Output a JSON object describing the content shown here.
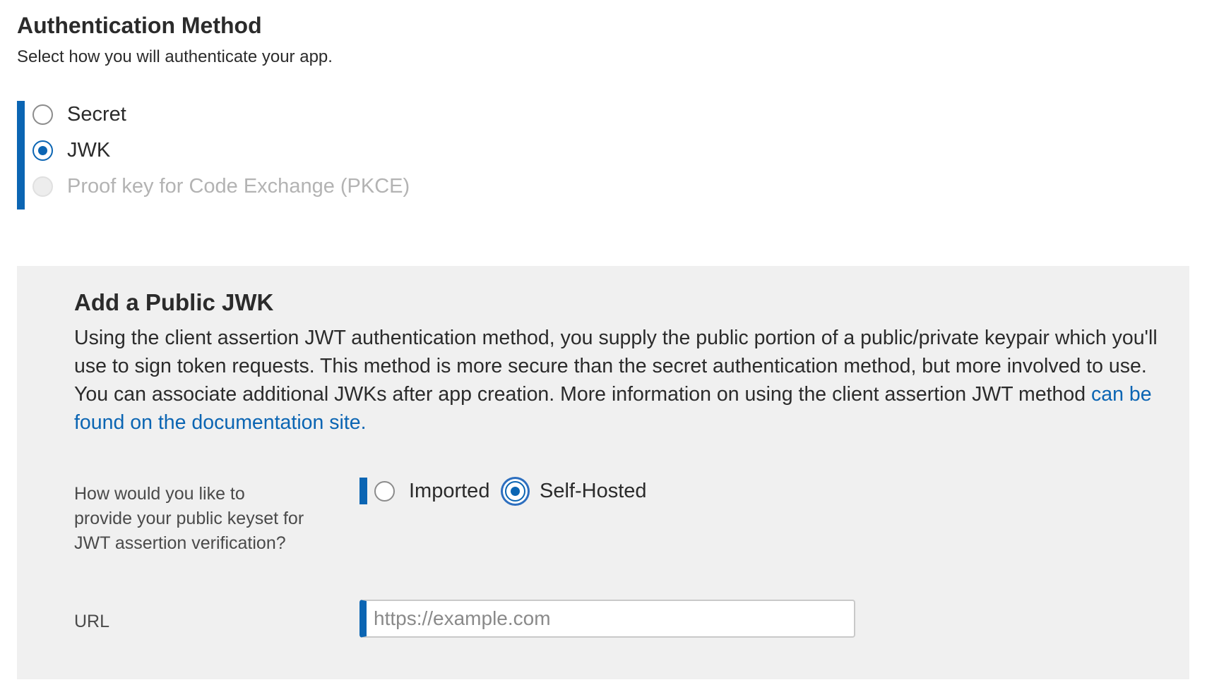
{
  "auth": {
    "title": "Authentication Method",
    "subtitle": "Select how you will authenticate your app.",
    "options": [
      {
        "label": "Secret",
        "checked": false,
        "disabled": false
      },
      {
        "label": "JWK",
        "checked": true,
        "disabled": false
      },
      {
        "label": "Proof key for Code Exchange (PKCE)",
        "checked": false,
        "disabled": true
      }
    ]
  },
  "jwk_panel": {
    "title": "Add a Public JWK",
    "description": "Using the client assertion JWT authentication method, you supply the public portion of a public/private keypair which you'll use to sign token requests. This method is more secure than the secret authentication method, but more involved to use. You can associate additional JWKs after app creation. More information on using the client assertion JWT method",
    "doc_link_text": "can be found on the documentation site.",
    "provide_question": "How would you like to provide your public keyset for JWT assertion verification?",
    "provide_options": [
      {
        "label": "Imported",
        "checked": false
      },
      {
        "label": "Self-Hosted",
        "checked": true
      }
    ],
    "url_label": "URL",
    "url_value": "",
    "url_placeholder": "https://example.com"
  },
  "colors": {
    "accent": "#0b65b3",
    "panel_bg": "#f0f0f0",
    "disabled_text": "#b3b3b3"
  }
}
